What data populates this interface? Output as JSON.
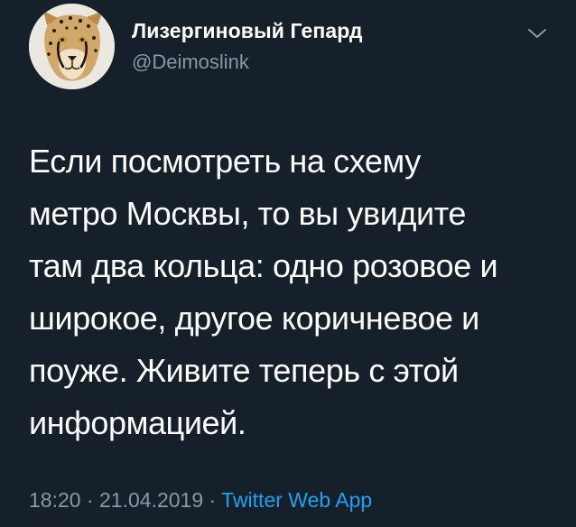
{
  "author": {
    "display_name": "Лизергиновый Гепард",
    "handle": "@Deimoslink",
    "avatar_icon": "cheetah-avatar"
  },
  "tweet": {
    "text": "Если посмотреть на схему\nметро Москвы, то вы увидите\nтам два кольца: одно розовое и\nширокое, другое коричневое и\nпоуже. Живите теперь с этой\nинформацией."
  },
  "meta": {
    "time": "18:20",
    "separator": " · ",
    "date": "21.04.2019",
    "source": "Twitter Web App"
  },
  "icons": {
    "more": "chevron-down-icon"
  },
  "colors": {
    "background": "#15202b",
    "primary_text": "#ffffff",
    "secondary_text": "#8899a6",
    "link": "#1da1f2"
  }
}
